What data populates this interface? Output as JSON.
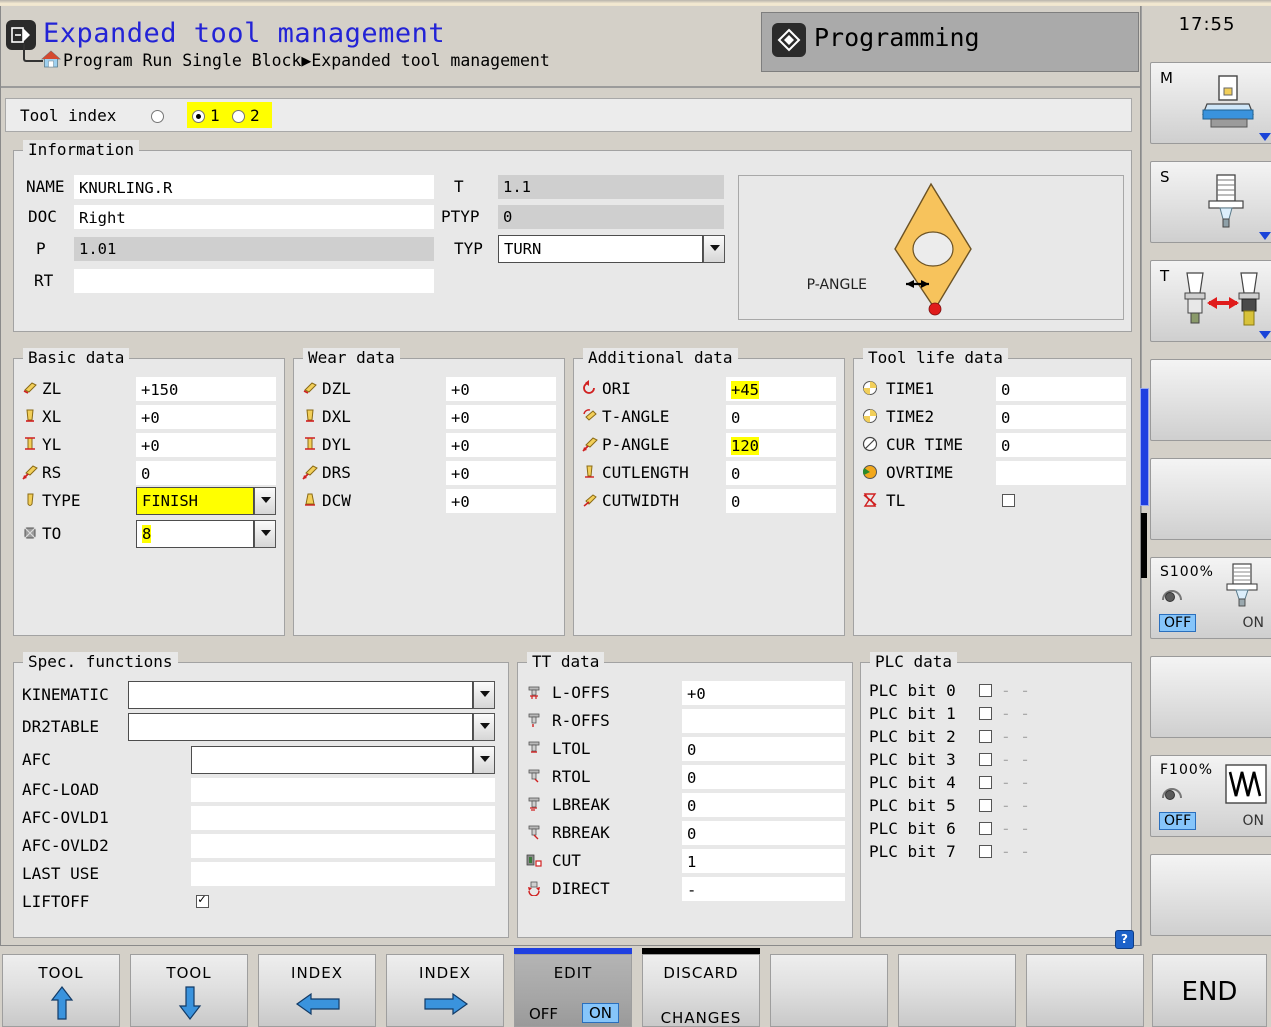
{
  "header": {
    "title": "Expanded tool management",
    "breadcrumb_text": "Program Run Single Block",
    "breadcrumb_arrow": "▶",
    "breadcrumb_current": "Expanded tool management",
    "mode_tab": "Programming",
    "app_icon": "program-icon",
    "home_icon": "home-icon",
    "mode_icon": "diamond-icon",
    "title_color": "#2323d6"
  },
  "tool_index": {
    "label": "Tool index",
    "options": [
      "",
      "1",
      "2"
    ],
    "selected": "1",
    "highlight_color": "#ffff00"
  },
  "information": {
    "legend": "Information",
    "fields": [
      {
        "label": "NAME",
        "value": "KNURLING.R",
        "style": "white"
      },
      {
        "label": "DOC",
        "value": "Right",
        "style": "white"
      },
      {
        "label": "P",
        "value": "1.01",
        "style": "gray"
      },
      {
        "label": "RT",
        "value": "",
        "style": "white"
      }
    ],
    "right_fields": [
      {
        "label": "T",
        "value": "1.1",
        "style": "gray"
      },
      {
        "label": "PTYP",
        "value": "0",
        "style": "gray"
      },
      {
        "label": "TYP",
        "value": "TURN",
        "style": "dropdown"
      }
    ]
  },
  "tool_graphic": {
    "annotation": "P-ANGLE",
    "shape": "rhombus-insert-icon",
    "body_color": "#f7c35c",
    "point_color": "#e01b1b"
  },
  "basic_data": {
    "legend": "Basic data",
    "rows": [
      {
        "icon": "tool-zl-icon",
        "label": "ZL",
        "value": "+150",
        "type": "text"
      },
      {
        "icon": "tool-xl-icon",
        "label": "XL",
        "value": "+0",
        "type": "text"
      },
      {
        "icon": "tool-yl-icon",
        "label": "YL",
        "value": "+0",
        "type": "text"
      },
      {
        "icon": "tool-rs-icon",
        "label": "RS",
        "value": "0",
        "type": "text"
      },
      {
        "icon": "tool-type-icon",
        "label": "TYPE",
        "value": "FINISH",
        "type": "dropdown",
        "highlight": true
      },
      {
        "icon": "tool-to-icon",
        "label": "TO",
        "value": "8",
        "type": "dropdown",
        "highlight": true
      }
    ]
  },
  "wear_data": {
    "legend": "Wear data",
    "rows": [
      {
        "icon": "wear-dzl-icon",
        "label": "DZL",
        "value": "+0"
      },
      {
        "icon": "wear-dxl-icon",
        "label": "DXL",
        "value": "+0"
      },
      {
        "icon": "wear-dyl-icon",
        "label": "DYL",
        "value": "+0"
      },
      {
        "icon": "wear-drs-icon",
        "label": "DRS",
        "value": "+0"
      },
      {
        "icon": "wear-dcw-icon",
        "label": "DCW",
        "value": "+0"
      }
    ]
  },
  "additional_data": {
    "legend": "Additional data",
    "rows": [
      {
        "icon": "orientation-icon",
        "label": "ORI",
        "value": "+45",
        "highlight": true
      },
      {
        "icon": "t-angle-icon",
        "label": "T-ANGLE",
        "value": "0",
        "highlight": false
      },
      {
        "icon": "p-angle-icon",
        "label": "P-ANGLE",
        "value": "120",
        "highlight": true
      },
      {
        "icon": "cutlength-icon",
        "label": "CUTLENGTH",
        "value": "0",
        "highlight": false
      },
      {
        "icon": "cutwidth-icon",
        "label": "CUTWIDTH",
        "value": "0",
        "highlight": false
      }
    ]
  },
  "tool_life_data": {
    "legend": "Tool life data",
    "rows": [
      {
        "icon": "clock-yellow-icon",
        "label": "TIME1",
        "value": "0",
        "type": "text"
      },
      {
        "icon": "clock-yellow-icon",
        "label": "TIME2",
        "value": "0",
        "type": "text"
      },
      {
        "icon": "clock-gray-icon",
        "label": "CUR TIME",
        "value": "0",
        "type": "text"
      },
      {
        "icon": "clock-green-icon",
        "label": "OVRTIME",
        "value": "",
        "type": "text"
      },
      {
        "icon": "tool-locked-icon",
        "label": "TL",
        "value": "",
        "type": "checkbox",
        "checked": false
      }
    ]
  },
  "spec_functions": {
    "legend": "Spec. functions",
    "rows": [
      {
        "label": "KINEMATIC",
        "value": "",
        "type": "dropdown-wide"
      },
      {
        "label": "DR2TABLE",
        "value": "",
        "type": "dropdown-wide"
      },
      {
        "label": "AFC",
        "value": "",
        "type": "dropdown-narrow"
      },
      {
        "label": "AFC-LOAD",
        "value": "",
        "type": "text"
      },
      {
        "label": "AFC-OVLD1",
        "value": "",
        "type": "text"
      },
      {
        "label": "AFC-OVLD2",
        "value": "",
        "type": "text"
      },
      {
        "label": "LAST USE",
        "value": "",
        "type": "text"
      },
      {
        "label": "LIFTOFF",
        "value": "",
        "type": "checkbox",
        "checked": true
      }
    ]
  },
  "tt_data": {
    "legend": "TT data",
    "rows": [
      {
        "icon": "tt-loffs-icon",
        "label": "L-OFFS",
        "value": "+0"
      },
      {
        "icon": "tt-roffs-icon",
        "label": "R-OFFS",
        "value": ""
      },
      {
        "icon": "tt-ltol-icon",
        "label": "LTOL",
        "value": "0"
      },
      {
        "icon": "tt-rtol-icon",
        "label": "RTOL",
        "value": "0"
      },
      {
        "icon": "tt-lbreak-icon",
        "label": "LBREAK",
        "value": "0"
      },
      {
        "icon": "tt-rbreak-icon",
        "label": "RBREAK",
        "value": "0"
      },
      {
        "icon": "tt-cut-icon",
        "label": "CUT",
        "value": "1"
      },
      {
        "icon": "tt-direct-icon",
        "label": "DIRECT",
        "value": "-"
      }
    ]
  },
  "plc_data": {
    "legend": "PLC data",
    "rows": [
      {
        "label": "PLC bit 0",
        "checked": false,
        "suffix": "- -"
      },
      {
        "label": "PLC bit 1",
        "checked": false,
        "suffix": "- -"
      },
      {
        "label": "PLC bit 2",
        "checked": false,
        "suffix": "- -"
      },
      {
        "label": "PLC bit 3",
        "checked": false,
        "suffix": "- -"
      },
      {
        "label": "PLC bit 4",
        "checked": false,
        "suffix": "- -"
      },
      {
        "label": "PLC bit 5",
        "checked": false,
        "suffix": "- -"
      },
      {
        "label": "PLC bit 6",
        "checked": false,
        "suffix": "- -"
      },
      {
        "label": "PLC bit 7",
        "checked": false,
        "suffix": "- -"
      }
    ]
  },
  "sidebar": {
    "clock": "17:55",
    "buttons": [
      {
        "key": "M",
        "icon": "machine-table-icon"
      },
      {
        "key": "S",
        "icon": "spindle-icon"
      },
      {
        "key": "T",
        "icon": "tool-change-icon"
      }
    ],
    "overrides": [
      {
        "label": "S100%",
        "icon": "spindle-override-icon",
        "off": "OFF",
        "on": "ON"
      },
      {
        "label": "F100%",
        "icon": "feed-override-icon",
        "off": "OFF",
        "on": "ON"
      }
    ]
  },
  "softkeys": [
    {
      "line1": "TOOL",
      "line2": "",
      "icon": "arrow-up-icon",
      "state": "normal"
    },
    {
      "line1": "TOOL",
      "line2": "",
      "icon": "arrow-down-icon",
      "state": "normal"
    },
    {
      "line1": "INDEX",
      "line2": "",
      "icon": "arrow-left-icon",
      "state": "normal"
    },
    {
      "line1": "INDEX",
      "line2": "",
      "icon": "arrow-right-icon",
      "state": "normal"
    },
    {
      "line1": "EDIT",
      "line2": "",
      "icon": "toggle-icon",
      "state": "active",
      "off": "OFF",
      "on": "ON"
    },
    {
      "line1": "DISCARD",
      "line2": "CHANGES",
      "icon": "",
      "state": "normal"
    },
    {
      "line1": "",
      "line2": "",
      "icon": "",
      "state": "normal"
    },
    {
      "line1": "",
      "line2": "",
      "icon": "",
      "state": "normal"
    }
  ],
  "end_key": {
    "label": "END"
  },
  "help": {
    "label": "?"
  }
}
